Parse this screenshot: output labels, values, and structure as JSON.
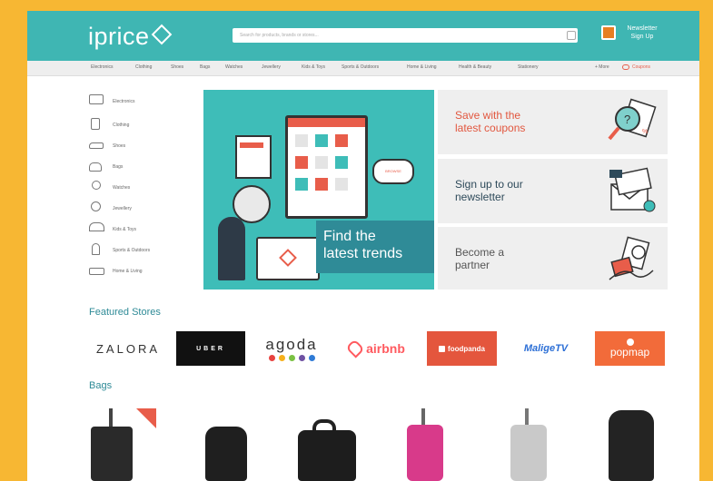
{
  "header": {
    "logo_text": "iprice",
    "search_placeholder": "Search for products, brands or stores...",
    "newsletter_line1": "Newsletter",
    "newsletter_line2": "Sign Up"
  },
  "nav": {
    "items": [
      "Electronics",
      "Clothing",
      "Shoes",
      "Bags",
      "Watches",
      "Jewellery",
      "Kids & Toys",
      "Sports & Outdoors",
      "Home & Living",
      "Health & Beauty",
      "Stationery"
    ],
    "more": "+ More",
    "coupons": "Coupons"
  },
  "sidebar": {
    "items": [
      {
        "label": "Electronics",
        "icon": "laptop-icon"
      },
      {
        "label": "Clothing",
        "icon": "shirt-icon"
      },
      {
        "label": "Shoes",
        "icon": "shoe-icon"
      },
      {
        "label": "Bags",
        "icon": "bag-icon"
      },
      {
        "label": "Watches",
        "icon": "watch-icon"
      },
      {
        "label": "Jewellery",
        "icon": "ring-icon"
      },
      {
        "label": "Kids & Toys",
        "icon": "rocking-horse-icon"
      },
      {
        "label": "Sports & Outdoors",
        "icon": "running-icon"
      },
      {
        "label": "Home & Living",
        "icon": "bed-icon"
      }
    ]
  },
  "hero": {
    "caption_line1": "Find the",
    "caption_line2": "latest trends",
    "badge": "BROWSE"
  },
  "promos": [
    {
      "line1": "Save with the",
      "line2": "latest coupons",
      "color": "#e2573f",
      "icon": "coupon-magnifier-icon"
    },
    {
      "line1": "Sign up to our",
      "line2": "newsletter",
      "color": "#2e4a5a",
      "icon": "newsletter-envelope-icon"
    },
    {
      "line1": "Become a",
      "line2": "partner",
      "color": "#555555",
      "icon": "handshake-icon"
    }
  ],
  "featured": {
    "title": "Featured Stores",
    "stores": [
      "ZALORA",
      "UBER",
      "agoda",
      "airbnb",
      "foodpanda",
      "MaligeTV",
      "popmap"
    ]
  },
  "bags": {
    "title": "Bags"
  },
  "colors": {
    "brand_teal": "#3fb6b3",
    "accent_orange": "#e85d4a",
    "section_title": "#2f8b97",
    "frame_yellow": "#f7b733"
  }
}
